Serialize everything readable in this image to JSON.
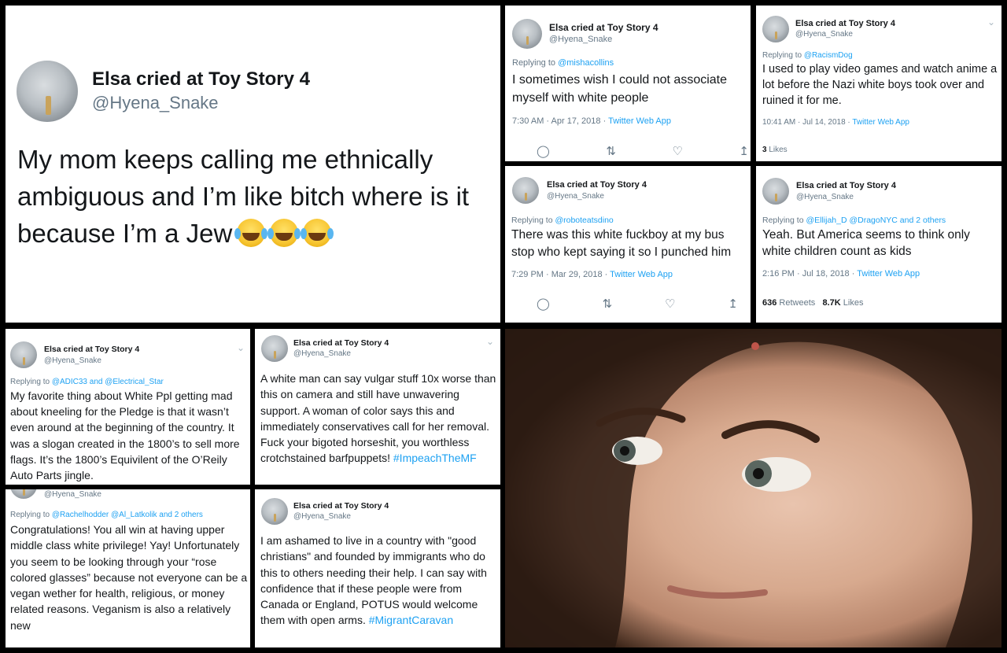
{
  "account": {
    "name": "Elsa cried at Toy Story 4",
    "handle": "@Hyena_Snake"
  },
  "tweets": {
    "t1": {
      "body": "My mom keeps calling me ethnically ambiguous and I’m like bitch where is it because I’m a Jew"
    },
    "t2": {
      "reply_prefix": "Replying to ",
      "reply_to": "@mishacollins",
      "body": "I sometimes wish I could not associate myself with white people",
      "time": "7:30 AM · Apr 17, 2018 · ",
      "source": "Twitter Web App"
    },
    "t3": {
      "reply_prefix": "Replying to ",
      "reply_to": "@RacismDog",
      "body": "I used to play video games and watch anime a lot before the Nazi white boys took over and ruined it for me.",
      "time": "10:41 AM · Jul 14, 2018 · ",
      "source": "Twitter Web App",
      "likes_count": "3",
      "likes_label": " Likes"
    },
    "t4": {
      "reply_prefix": "Replying to ",
      "reply_to": "@roboteatsdino",
      "body": "There was this white fuckboy at my bus stop who kept saying it so I punched him",
      "time": "7:29 PM · Mar 29, 2018 · ",
      "source": "Twitter Web App"
    },
    "t5": {
      "reply_prefix": "Replying to ",
      "reply_to": "@Ellijah_D @DragoNYC and 2 others",
      "body": "Yeah. But America seems to think only white children count as kids",
      "time": "2:16 PM · Jul 18, 2018 · ",
      "source": "Twitter Web App",
      "retweets_count": "636",
      "retweets_label": " Retweets",
      "likes_count": "8.7K",
      "likes_label": " Likes"
    },
    "t6": {
      "reply_prefix": "Replying to ",
      "reply_to": "@ADIC33 and @Electrical_Star",
      "body": "My favorite thing about White Ppl getting mad about kneeling for the Pledge is that it wasn’t even around at the beginning of the country. It was a slogan created in the 1800’s to sell more flags. It’s the 1800’s Equivilent of the O’Reily Auto Parts jingle."
    },
    "t7": {
      "body": "A white man can say vulgar stuff 10x worse than this on camera and still have unwavering support. A woman of color says this and immediately conservatives call for her removal. Fuck your bigoted horseshit, you worthless crotchstained barfpuppets! ",
      "hashtag": "#ImpeachTheMF"
    },
    "t8": {
      "reply_prefix": "Replying to ",
      "reply_to": "@Rachelhodder @Al_Latkolik and 2 others",
      "body": "Congratulations! You all win at having upper middle class white privilege! Yay! Unfortunately you seem to be looking through your “rose colored glasses” because not everyone can be a vegan wether for health, religious, or money related reasons. Veganism is also a relatively new"
    },
    "t9": {
      "body": "I am ashamed to live in a country with \"good christians\" and founded by immigrants who do this to others needing their help. I can say with confidence that if these people were from Canada or England, POTUS would welcome them with open arms. ",
      "hashtag": "#MigrantCaravan"
    }
  },
  "icons": {
    "reply": "reply-icon",
    "retweet": "retweet-icon",
    "like": "heart-icon",
    "share": "share-icon",
    "menu": "chevron-down-icon"
  },
  "colors": {
    "link": "#1da1f2",
    "muted": "#657786",
    "text": "#14171a",
    "background": "#000000"
  }
}
